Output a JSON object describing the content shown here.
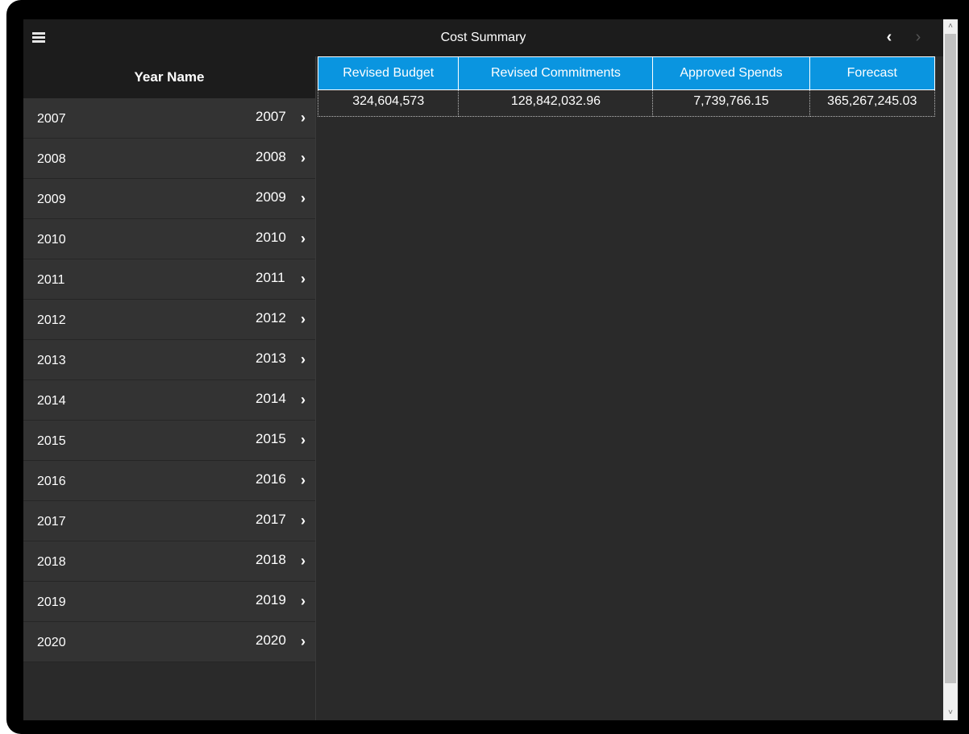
{
  "header": {
    "title": "Cost Summary",
    "menu_icon": "hamburger-menu-icon",
    "prev_icon": "chevron-left-icon",
    "next_icon": "chevron-right-icon",
    "prev_glyph": "‹",
    "next_glyph": "›"
  },
  "left_panel": {
    "header": "Year Name",
    "chevron_glyph": "›",
    "years": [
      {
        "name": "2007",
        "value": "2007"
      },
      {
        "name": "2008",
        "value": "2008"
      },
      {
        "name": "2009",
        "value": "2009"
      },
      {
        "name": "2010",
        "value": "2010"
      },
      {
        "name": "2011",
        "value": "2011"
      },
      {
        "name": "2012",
        "value": "2012"
      },
      {
        "name": "2013",
        "value": "2013"
      },
      {
        "name": "2014",
        "value": "2014"
      },
      {
        "name": "2015",
        "value": "2015"
      },
      {
        "name": "2016",
        "value": "2016"
      },
      {
        "name": "2017",
        "value": "2017"
      },
      {
        "name": "2018",
        "value": "2018"
      },
      {
        "name": "2019",
        "value": "2019"
      },
      {
        "name": "2020",
        "value": "2020"
      }
    ]
  },
  "table": {
    "columns": [
      "Revised Budget",
      "Revised Commitments",
      "Approved Spends",
      "Forecast"
    ],
    "rows": [
      [
        "324,604,573",
        "128,842,032.96",
        "7,739,766.15",
        "365,267,245.03"
      ]
    ]
  },
  "scrollbar": {
    "up_glyph": "˄",
    "down_glyph": "˅"
  },
  "colors": {
    "header_blue": "#0a95e0",
    "titlebar": "#1c1c1c",
    "panel": "#2a2a2a",
    "row": "#333333"
  }
}
